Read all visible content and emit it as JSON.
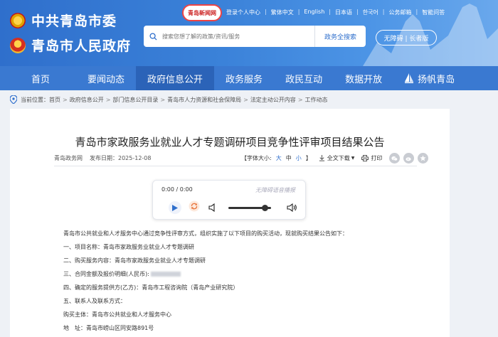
{
  "header": {
    "brand_party": "中共青岛市委",
    "brand_gov": "青岛市人民政府",
    "news_logo": "青岛新闻网",
    "top_links": [
      "登录个人中心",
      "繁体中文",
      "English",
      "日本语",
      "한국어",
      "公务邮箱",
      "智能问答"
    ],
    "search_placeholder": "搜索您想了解的政策/资讯/服务",
    "search_button": "政务全搜索",
    "accessibility": "无障碍 | 长者版"
  },
  "nav": {
    "items": [
      "首页",
      "要闻动态",
      "政府信息公开",
      "政务服务",
      "政民互动",
      "数据开放",
      "扬帆青岛"
    ],
    "active_index": 2
  },
  "breadcrumb": {
    "prefix": "当前位置：",
    "items": [
      "首页",
      "政府信息公开",
      "部门信息公开目录",
      "青岛市人力资源和社会保障局",
      "法定主动公开内容",
      "工作动态"
    ]
  },
  "article": {
    "title": "青岛市家政服务业就业人才专题调研项目竞争性评审项目结果公告",
    "source": "青岛政务网",
    "date": "发布日期：2025-12-08",
    "font_size_label": "【字体大小:",
    "font_big": "大",
    "font_mid": "中",
    "font_small": "小",
    "font_close": "】",
    "download": "全文下载",
    "print": "打印",
    "lines": [
      "青岛市公共就业和人才服务中心通过竞争性评审方式，组织实施了以下项目的购买活动，现就购买结果公告如下：",
      "一、项目名称：青岛市家政服务业就业人才专题调研",
      "二、购买服务内容：青岛市家政服务业就业人才专题调研",
      "三、合同金额及报价明细(人民币):",
      "四、确定的服务提供方(乙方)：青岛市工程咨询院（青岛产业研究院）",
      "五、联系人及联系方式：",
      "购买主体：青岛市公共就业和人才服务中心",
      "地　址：青岛市崂山区同安路891号"
    ]
  },
  "audio": {
    "time": "0:00 / 0:00",
    "hint": "无障碍语音播报",
    "volume": 0.85
  },
  "colors": {
    "header": "#3b82d9",
    "nav": "#3a79d1",
    "nav_active": "#2b63b8",
    "accent": "#2f6fcc"
  }
}
